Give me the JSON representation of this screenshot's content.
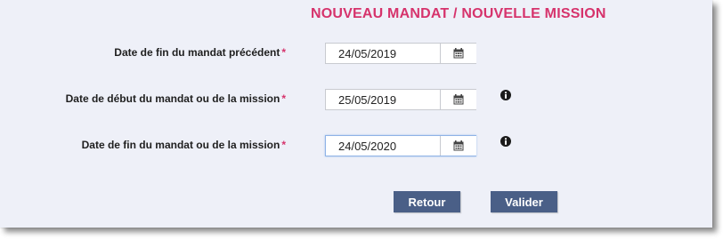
{
  "header": {
    "title": "NOUVEAU MANDAT / NOUVELLE MISSION"
  },
  "fields": [
    {
      "label": "Date de fin du mandat précédent",
      "required_mark": "*",
      "value": "24/05/2019",
      "has_info": false
    },
    {
      "label": "Date de début du mandat ou de la mission",
      "required_mark": "*",
      "value": "25/05/2019",
      "has_info": true
    },
    {
      "label": "Date de fin du mandat ou de la mission",
      "required_mark": "*",
      "value": "24/05/2020",
      "has_info": true
    }
  ],
  "actions": {
    "back_label": "Retour",
    "submit_label": "Valider"
  },
  "colors": {
    "title": "#d6336c",
    "required": "#d6336c",
    "button_bg": "#4a5f87",
    "panel_bg": "#eef0f8"
  },
  "icons": {
    "calendar": "calendar-icon",
    "info": "info-icon"
  }
}
